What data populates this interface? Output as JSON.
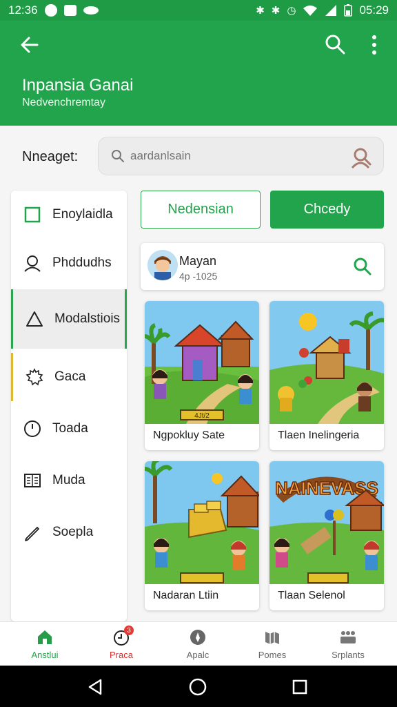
{
  "status_bar": {
    "time": "12:36",
    "battery_time": "05:29"
  },
  "app_bar": {
    "title": "Inpansia Ganai",
    "subtitle": "Nedvenchremtay"
  },
  "search": {
    "label": "Nneaget:",
    "placeholder": "aardanlsain"
  },
  "sidebar": {
    "items": [
      {
        "label": "Enoylaidla",
        "icon": "square-icon"
      },
      {
        "label": "Phddudhs",
        "icon": "person-icon"
      },
      {
        "label": "Modalstiois",
        "icon": "triangle-icon"
      },
      {
        "label": "Gaca",
        "icon": "gear-icon"
      },
      {
        "label": "Toada",
        "icon": "clock-icon"
      },
      {
        "label": "Muda",
        "icon": "book-icon"
      },
      {
        "label": "Soepla",
        "icon": "pencil-icon"
      }
    ]
  },
  "tabs": {
    "outline": "Nedensian",
    "filled": "Chcedy"
  },
  "user_card": {
    "name": "Mayan",
    "code": "4p -1025"
  },
  "cards": [
    {
      "caption": "Ngpokluy Sate",
      "sign": "4Jt/2"
    },
    {
      "caption": "Tlaen Inelingeria"
    },
    {
      "caption": "Nadaran Ltiin"
    },
    {
      "caption": "Tlaan Selenol",
      "banner": "NAINEVASS"
    }
  ],
  "bottom_nav": {
    "items": [
      {
        "label": "Anstlui",
        "icon": "home-icon",
        "active": true
      },
      {
        "label": "Praca",
        "icon": "alarm-icon",
        "badge": "3"
      },
      {
        "label": "Apalc",
        "icon": "compass-icon"
      },
      {
        "label": "Pomes",
        "icon": "map-icon"
      },
      {
        "label": "Srplants",
        "icon": "group-icon"
      }
    ]
  },
  "colors": {
    "primary": "#21a44b",
    "accent": "#2aa64f",
    "badge": "#e53935"
  }
}
